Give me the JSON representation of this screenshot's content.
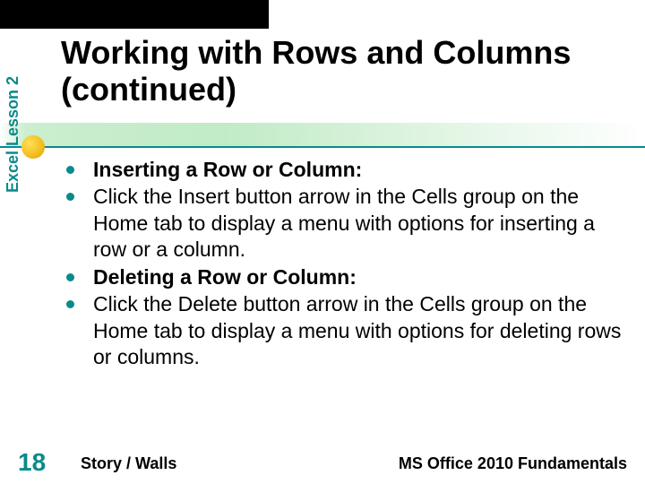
{
  "sidebar": {
    "label": "Excel Lesson 2"
  },
  "title": "Working with Rows and Columns (continued)",
  "bullets": [
    {
      "text": "Inserting a Row or Column:",
      "bold": true
    },
    {
      "text": "Click the Insert button arrow in the Cells group on the Home tab to display a menu with options for inserting a row or a column.",
      "bold": false
    },
    {
      "text": "Deleting a Row or Column:",
      "bold": true
    },
    {
      "text": "Click the Delete button arrow in the Cells group on the Home tab to display a menu with options for deleting rows or columns.",
      "bold": false
    }
  ],
  "footer": {
    "slide_number": "18",
    "left": "Story / Walls",
    "right": "MS Office 2010 Fundamentals"
  }
}
